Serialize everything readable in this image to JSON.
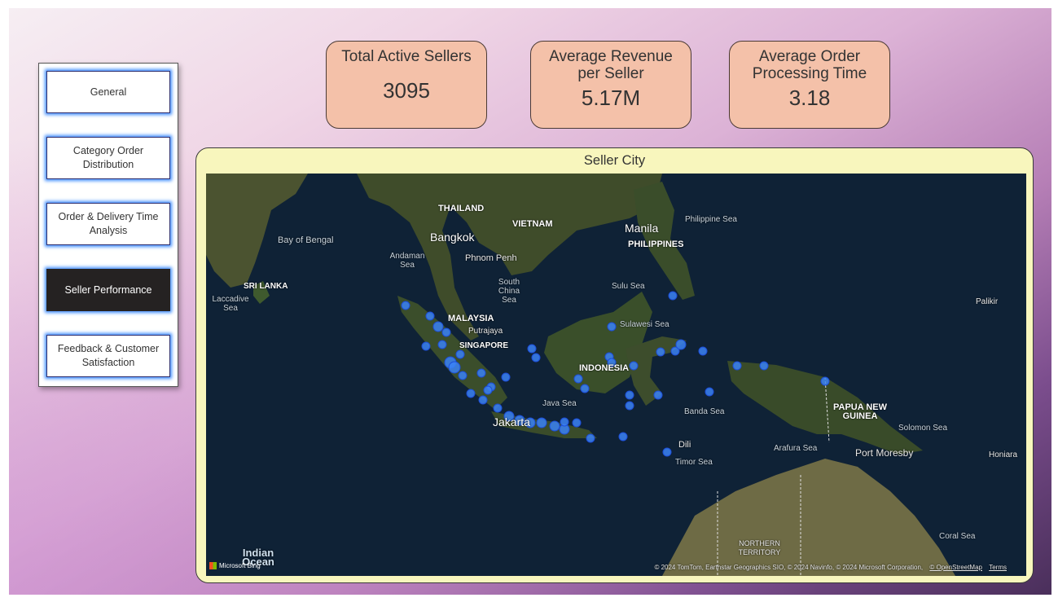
{
  "nav": {
    "items": [
      {
        "label": "General",
        "active": false
      },
      {
        "label": "Category Order Distribution",
        "active": false
      },
      {
        "label": "Order & Delivery Time Analysis",
        "active": false
      },
      {
        "label": "Seller Performance",
        "active": true
      },
      {
        "label": "Feedback & Customer Satisfaction",
        "active": false
      }
    ]
  },
  "kpis": [
    {
      "title": "Total Active Sellers",
      "value": "3095"
    },
    {
      "title": "Average Revenue per Seller",
      "value": "5.17M"
    },
    {
      "title": "Average Order Processing Time",
      "value": "3.18"
    }
  ],
  "map": {
    "title": "Seller City",
    "labels": {
      "thailand": "THAILAND",
      "bangkok": "Bangkok",
      "vietnam": "VIETNAM",
      "phnom_penh": "Phnom Penh",
      "manila": "Manila",
      "philippines": "PHILIPPINES",
      "philippine_sea": "Philippine Sea",
      "bay_of_bengal": "Bay of Bengal",
      "andaman_sea": "Andaman Sea",
      "sri_lanka": "SRI LANKA",
      "laccadive_sea": "Laccadive Sea",
      "south_china_sea": "South China Sea",
      "sulu_sea": "Sulu Sea",
      "malaysia": "MALAYSIA",
      "putrajaya": "Putrajaya",
      "singapore": "SINGAPORE",
      "sulawesi_sea": "Sulawesi Sea",
      "palikir": "Palikir",
      "indonesia": "INDONESIA",
      "java_sea": "Java Sea",
      "banda_sea": "Banda Sea",
      "papua_new_guinea": "PAPUA NEW GUINEA",
      "solomon_sea": "Solomon Sea",
      "jakarta": "Jakarta",
      "dili": "Dili",
      "arafura_sea": "Arafura Sea",
      "port_moresby": "Port Moresby",
      "honiara": "Honiara",
      "timor_sea": "Timor Sea",
      "northern_territory": "NORTHERN TERRITORY",
      "coral_sea": "Coral Sea",
      "indian_ocean": "Indian Ocean"
    },
    "attribution": "© 2024 TomTom, Earthstar Geographics SIO, © 2024 Navinfo, © 2024 Microsoft Corporation,",
    "osm_link": "© OpenStreetMap",
    "terms_link": "Terms",
    "logo_text": "Microsoft Bing",
    "colors": {
      "land": "#3c4a2a",
      "water": "#0f2236",
      "dot": "#3b82f6",
      "card": "#f8f6bd",
      "kpi": "#f4c1a9"
    }
  }
}
